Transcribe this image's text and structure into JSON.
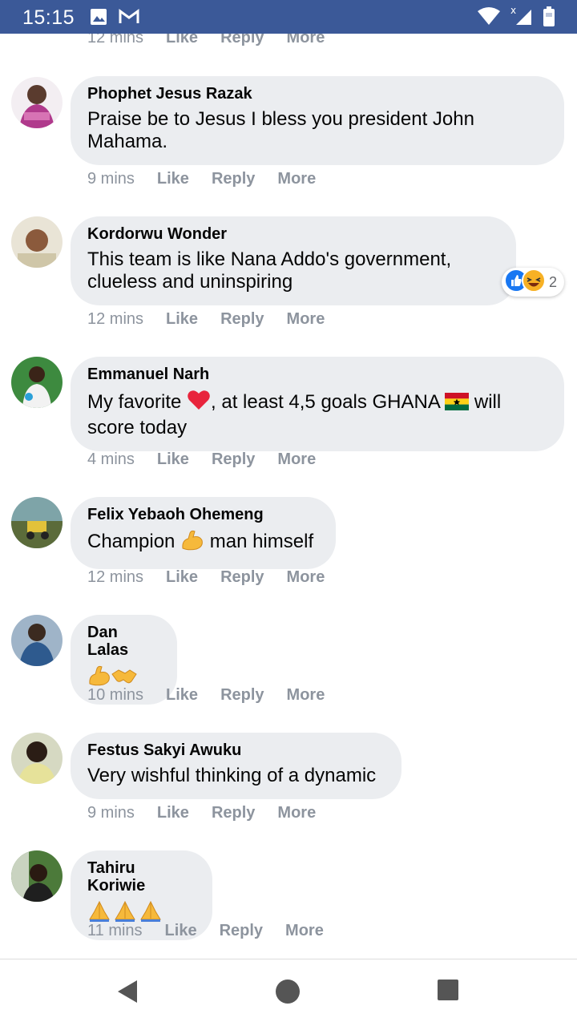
{
  "status_bar": {
    "time": "15:15"
  },
  "top_partial": {
    "time": "12 mins",
    "like": "Like",
    "reply": "Reply",
    "more": "More"
  },
  "comments": [
    {
      "author": "Phophet Jesus Razak",
      "text": "Praise be to Jesus I bless you president John Mahama.",
      "time": "9 mins",
      "like": "Like",
      "reply": "Reply",
      "more": "More"
    },
    {
      "author": "Kordorwu Wonder",
      "text": "This team is like Nana Addo's government, clueless and uninspiring",
      "time": "12 mins",
      "like": "Like",
      "reply": "Reply",
      "more": "More",
      "reaction_count": "2"
    },
    {
      "author": "Emmanuel Narh",
      "text_before": "My favorite ",
      "text_mid": ", at least 4,5 goals GHANA ",
      "text_after": " will score today",
      "time": "4 mins",
      "like": "Like",
      "reply": "Reply",
      "more": "More"
    },
    {
      "author": "Felix Yebaoh Ohemeng",
      "text_before": "Champion ",
      "text_after": " man himself",
      "time": "12 mins",
      "like": "Like",
      "reply": "Reply",
      "more": "More"
    },
    {
      "author": "Dan Lalas",
      "time": "10 mins",
      "like": "Like",
      "reply": "Reply",
      "more": "More"
    },
    {
      "author": "Festus Sakyi Awuku",
      "text": "Very wishful thinking of a dynamic",
      "time": "9 mins",
      "like": "Like",
      "reply": "Reply",
      "more": "More"
    },
    {
      "author": "Tahiru Koriwie",
      "time": "11 mins",
      "like": "Like",
      "reply": "Reply",
      "more": "More"
    }
  ],
  "icons": {
    "status": [
      "gallery-icon",
      "gmail-icon",
      "wifi-icon",
      "signal-icon",
      "battery-icon"
    ],
    "nav": [
      "back-icon",
      "home-icon",
      "recents-icon"
    ],
    "emoji": [
      "heart-emoji",
      "ghana-flag-emoji",
      "flexed-biceps-emoji",
      "handshake-emoji",
      "folded-hands-emoji"
    ],
    "reactions": [
      "like-reaction-icon",
      "haha-reaction-icon"
    ]
  },
  "colors": {
    "status_bar": "#3b5998",
    "bubble": "#ebedf0",
    "action_text": "#8d949e",
    "like_blue": "#1877f2"
  }
}
